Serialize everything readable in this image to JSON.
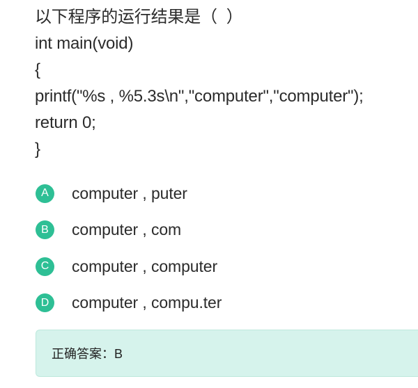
{
  "question": {
    "lines": [
      "以下程序的运行结果是（  ）",
      "int main(void)",
      "{",
      "printf(\"%s , %5.3s\\n\",\"computer\",\"computer\");",
      "return 0;",
      "}"
    ]
  },
  "options": [
    {
      "letter": "A",
      "text": "computer , puter"
    },
    {
      "letter": "B",
      "text": "computer , com"
    },
    {
      "letter": "C",
      "text": "computer , computer"
    },
    {
      "letter": "D",
      "text": "computer , compu.ter"
    }
  ],
  "answer": {
    "label": "正确答案：B"
  },
  "colors": {
    "accent": "#2ebf95",
    "answer_bg": "#d6f3ec",
    "text": "#2b2b2b"
  }
}
